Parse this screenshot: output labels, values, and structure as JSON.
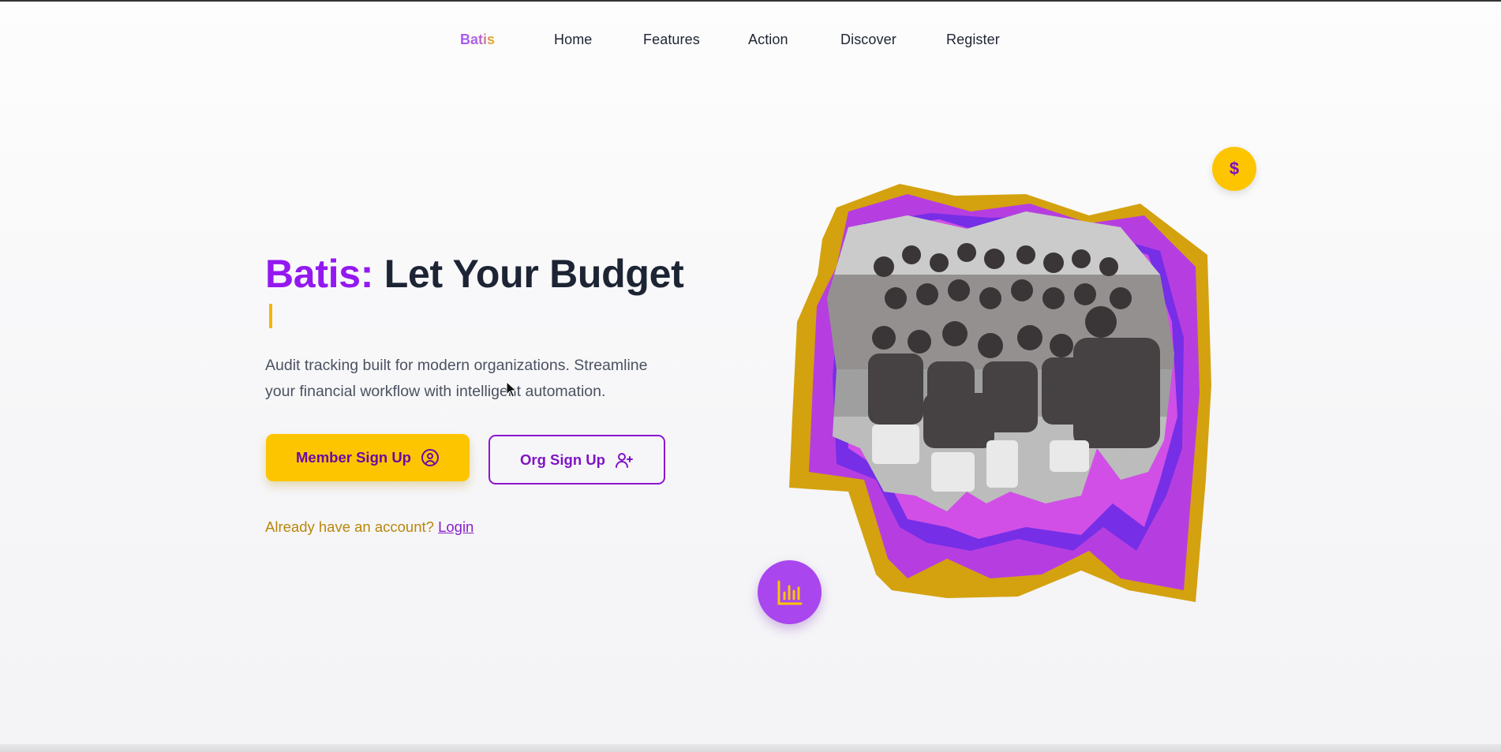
{
  "nav": {
    "brand": "Batis",
    "links": [
      "Home",
      "Features",
      "Action",
      "Discover",
      "Register"
    ]
  },
  "hero": {
    "title_brand": "Batis:",
    "title_rest": "Let Your Budget",
    "description": "Audit tracking built for modern organizations. Streamline your financial workflow with intelligent automation.",
    "member_button": "Member Sign Up",
    "org_button": "Org Sign Up",
    "login_prompt": "Already have an account?",
    "login_link": "Login"
  },
  "badges": {
    "coin_symbol": "$"
  },
  "icons": {
    "member_button": "user-circle-icon",
    "org_button": "user-plus-icon",
    "floating_badge": "bar-chart-icon"
  },
  "colors": {
    "brand_purple": "#9418f0",
    "accent_yellow": "#fdc500",
    "text_dark": "#1d2434",
    "login_gold": "#b8860b"
  }
}
